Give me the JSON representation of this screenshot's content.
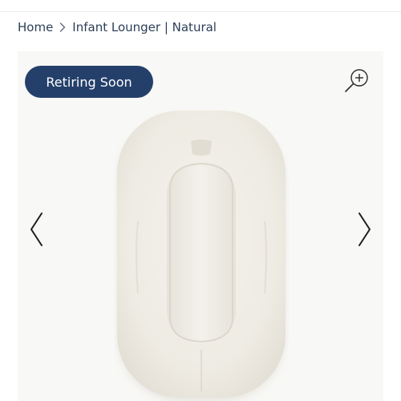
{
  "breadcrumb": {
    "home_label": "Home",
    "current_label": "Infant Lounger | Natural"
  },
  "gallery": {
    "badge_label": "Retiring Soon",
    "icons": {
      "zoom": "zoom-in-icon",
      "prev": "chevron-left-icon",
      "next": "chevron-right-icon",
      "separator": "chevron-right-icon"
    },
    "colors": {
      "badge_bg": "#24406a",
      "badge_text": "#ffffff",
      "gallery_bg": "#f8f8f6",
      "product": "#eeebe3"
    }
  }
}
